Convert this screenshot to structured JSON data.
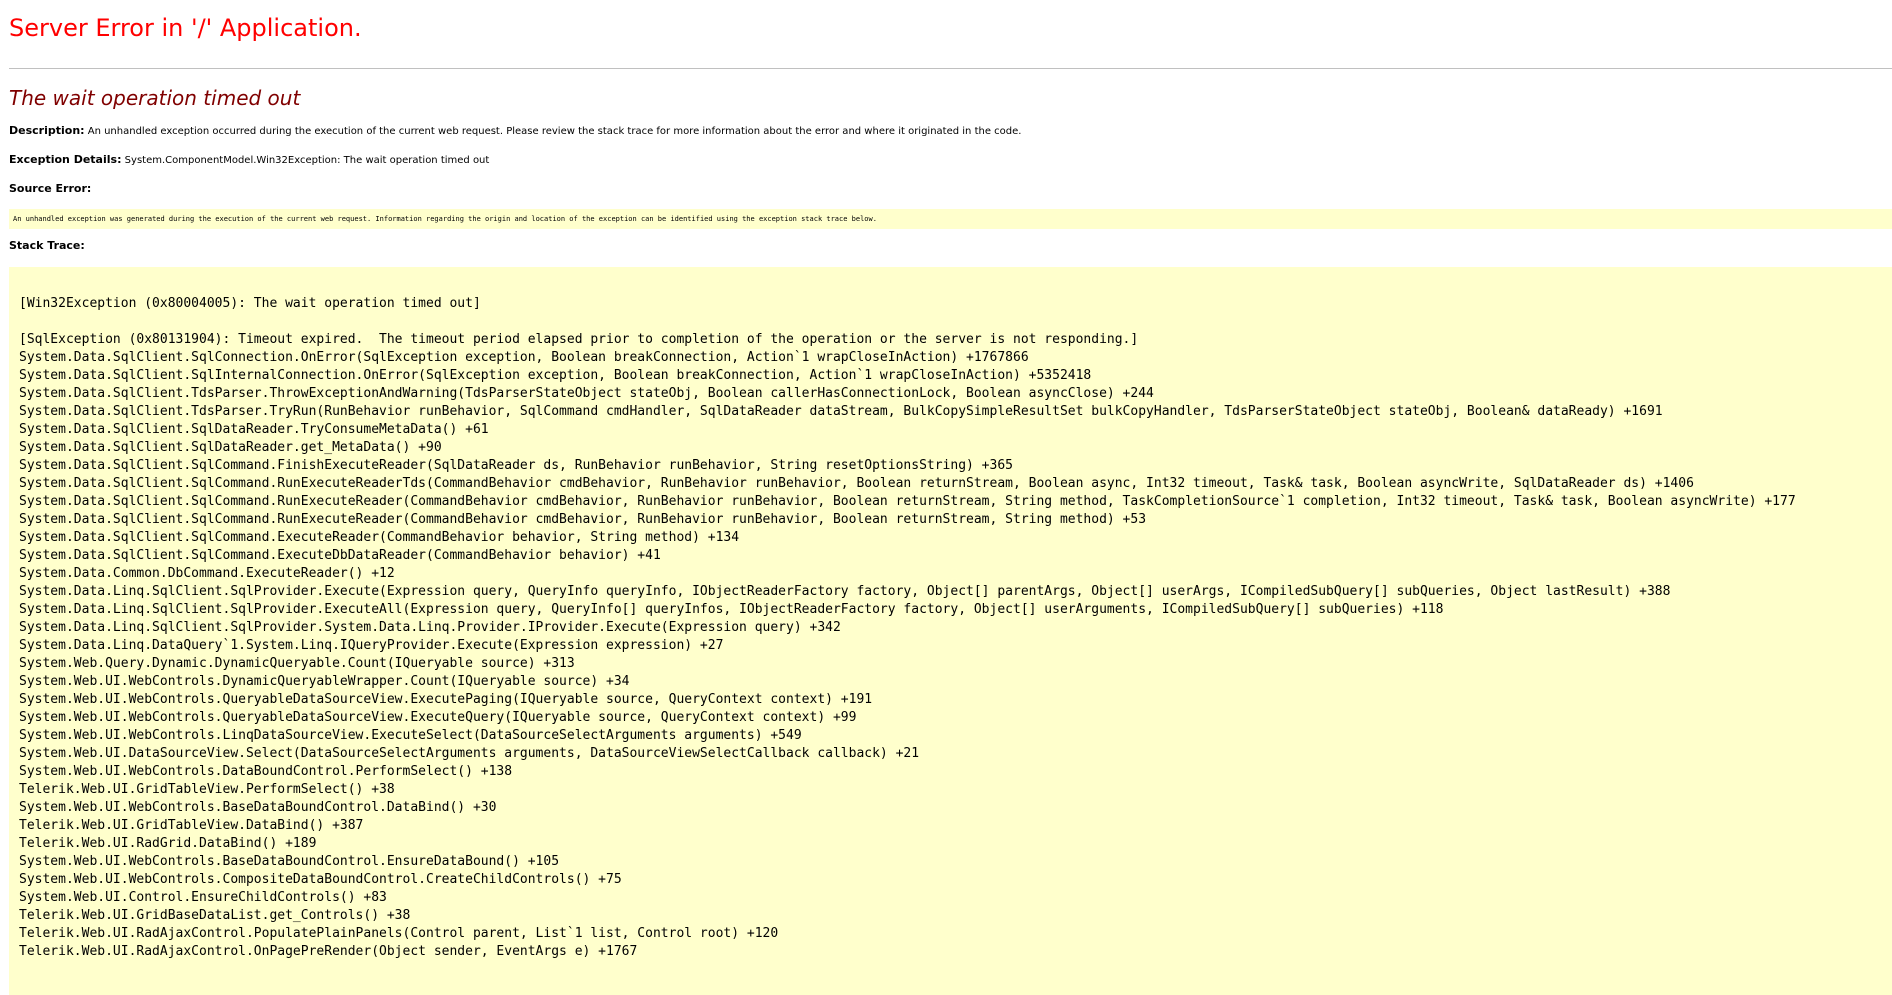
{
  "header": {
    "title": "Server Error in '/' Application.",
    "message": "The wait operation timed out"
  },
  "description": {
    "label": "Description:",
    "text": "An unhandled exception occurred during the execution of the current web request. Please review the stack trace for more information about the error and where it originated in the code."
  },
  "exception": {
    "label": "Exception Details:",
    "text": "System.ComponentModel.Win32Exception: The wait operation timed out"
  },
  "source_error": {
    "label": "Source Error:",
    "text": "An unhandled exception was generated during the execution of the current web request. Information regarding the origin and location of the exception can be identified using the exception stack trace below."
  },
  "stack": {
    "label": "Stack Trace:",
    "win32": "[Win32Exception (0x80004005): The wait operation timed out]",
    "sql": "[SqlException (0x80131904): Timeout expired.  The timeout period elapsed prior to completion of the operation or the server is not responding.]",
    "lines": [
      "System.Data.SqlClient.SqlConnection.OnError(SqlException exception, Boolean breakConnection, Action`1 wrapCloseInAction) +1767866",
      "System.Data.SqlClient.SqlInternalConnection.OnError(SqlException exception, Boolean breakConnection, Action`1 wrapCloseInAction) +5352418",
      "System.Data.SqlClient.TdsParser.ThrowExceptionAndWarning(TdsParserStateObject stateObj, Boolean callerHasConnectionLock, Boolean asyncClose) +244",
      "System.Data.SqlClient.TdsParser.TryRun(RunBehavior runBehavior, SqlCommand cmdHandler, SqlDataReader dataStream, BulkCopySimpleResultSet bulkCopyHandler, TdsParserStateObject stateObj, Boolean& dataReady) +1691",
      "System.Data.SqlClient.SqlDataReader.TryConsumeMetaData() +61",
      "System.Data.SqlClient.SqlDataReader.get_MetaData() +90",
      "System.Data.SqlClient.SqlCommand.FinishExecuteReader(SqlDataReader ds, RunBehavior runBehavior, String resetOptionsString) +365",
      "System.Data.SqlClient.SqlCommand.RunExecuteReaderTds(CommandBehavior cmdBehavior, RunBehavior runBehavior, Boolean returnStream, Boolean async, Int32 timeout, Task& task, Boolean asyncWrite, SqlDataReader ds) +1406",
      "System.Data.SqlClient.SqlCommand.RunExecuteReader(CommandBehavior cmdBehavior, RunBehavior runBehavior, Boolean returnStream, String method, TaskCompletionSource`1 completion, Int32 timeout, Task& task, Boolean asyncWrite) +177",
      "System.Data.SqlClient.SqlCommand.RunExecuteReader(CommandBehavior cmdBehavior, RunBehavior runBehavior, Boolean returnStream, String method) +53",
      "System.Data.SqlClient.SqlCommand.ExecuteReader(CommandBehavior behavior, String method) +134",
      "System.Data.SqlClient.SqlCommand.ExecuteDbDataReader(CommandBehavior behavior) +41",
      "System.Data.Common.DbCommand.ExecuteReader() +12",
      "System.Data.Linq.SqlClient.SqlProvider.Execute(Expression query, QueryInfo queryInfo, IObjectReaderFactory factory, Object[] parentArgs, Object[] userArgs, ICompiledSubQuery[] subQueries, Object lastResult) +388",
      "System.Data.Linq.SqlClient.SqlProvider.ExecuteAll(Expression query, QueryInfo[] queryInfos, IObjectReaderFactory factory, Object[] userArguments, ICompiledSubQuery[] subQueries) +118",
      "System.Data.Linq.SqlClient.SqlProvider.System.Data.Linq.Provider.IProvider.Execute(Expression query) +342",
      "System.Data.Linq.DataQuery`1.System.Linq.IQueryProvider.Execute(Expression expression) +27",
      "System.Web.Query.Dynamic.DynamicQueryable.Count(IQueryable source) +313",
      "System.Web.UI.WebControls.DynamicQueryableWrapper.Count(IQueryable source) +34",
      "System.Web.UI.WebControls.QueryableDataSourceView.ExecutePaging(IQueryable source, QueryContext context) +191",
      "System.Web.UI.WebControls.QueryableDataSourceView.ExecuteQuery(IQueryable source, QueryContext context) +99",
      "System.Web.UI.WebControls.LinqDataSourceView.ExecuteSelect(DataSourceSelectArguments arguments) +549",
      "System.Web.UI.DataSourceView.Select(DataSourceSelectArguments arguments, DataSourceViewSelectCallback callback) +21",
      "System.Web.UI.WebControls.DataBoundControl.PerformSelect() +138",
      "Telerik.Web.UI.GridTableView.PerformSelect() +38",
      "System.Web.UI.WebControls.BaseDataBoundControl.DataBind() +30",
      "Telerik.Web.UI.GridTableView.DataBind() +387",
      "Telerik.Web.UI.RadGrid.DataBind() +189",
      "System.Web.UI.WebControls.BaseDataBoundControl.EnsureDataBound() +105",
      "System.Web.UI.WebControls.CompositeDataBoundControl.CreateChildControls() +75",
      "System.Web.UI.Control.EnsureChildControls() +83",
      "Telerik.Web.UI.GridBaseDataList.get_Controls() +38",
      "Telerik.Web.UI.RadAjaxControl.PopulatePlainPanels(Control parent, List`1 list, Control root) +120",
      "Telerik.Web.UI.RadAjaxControl.OnPagePreRender(Object sender, EventArgs e) +1767"
    ]
  }
}
